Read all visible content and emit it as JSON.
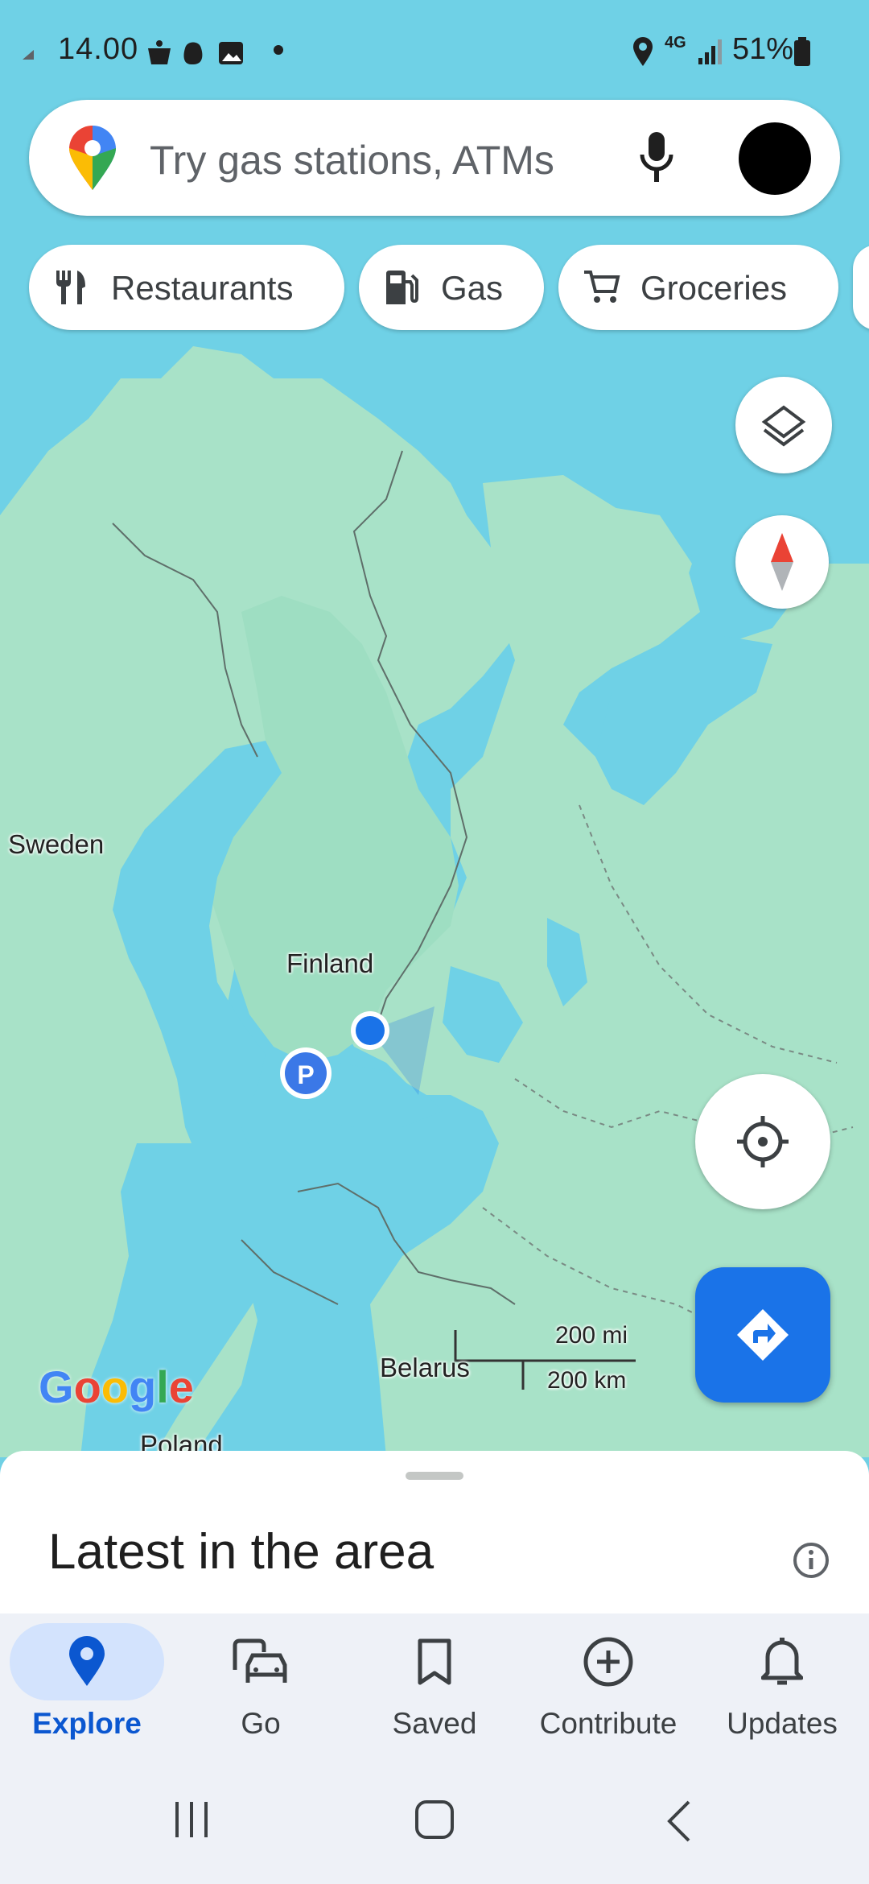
{
  "status_bar": {
    "time": "14.00",
    "network": "4G",
    "battery": "51%",
    "icons": [
      "cast-icon",
      "coffee-notification-icon",
      "snapchat-icon",
      "gallery-icon",
      "dot-icon",
      "location-icon",
      "signal-icon",
      "battery-icon"
    ]
  },
  "search": {
    "placeholder": "Try gas stations, ATMs",
    "icons": [
      "maps-pin-logo",
      "microphone-icon",
      "avatar"
    ]
  },
  "chips": [
    {
      "label": "Restaurants",
      "icon": "fork-knife-icon"
    },
    {
      "label": "Gas",
      "icon": "gas-pump-icon"
    },
    {
      "label": "Groceries",
      "icon": "cart-icon"
    }
  ],
  "map": {
    "labels": {
      "sweden": "Sweden",
      "finland": "Finland",
      "belarus": "Belarus",
      "poland": "Poland"
    },
    "scale": {
      "miles": "200 mi",
      "km": "200 km"
    },
    "logo": "Google",
    "colors": {
      "water": "#6fd1e6",
      "land": "#a8e2c8",
      "location_dot": "#1a73e8",
      "directions_fab": "#1a73e8"
    }
  },
  "sheet": {
    "title": "Latest in the area",
    "icon": "info-icon"
  },
  "bottom_nav": [
    {
      "label": "Explore",
      "icon": "explore-pin-icon",
      "active": true
    },
    {
      "label": "Go",
      "icon": "commute-icon",
      "active": false
    },
    {
      "label": "Saved",
      "icon": "bookmark-icon",
      "active": false
    },
    {
      "label": "Contribute",
      "icon": "add-circle-icon",
      "active": false
    },
    {
      "label": "Updates",
      "icon": "bell-icon",
      "active": false
    }
  ],
  "system_nav": [
    "recents-icon",
    "home-icon",
    "back-icon"
  ]
}
